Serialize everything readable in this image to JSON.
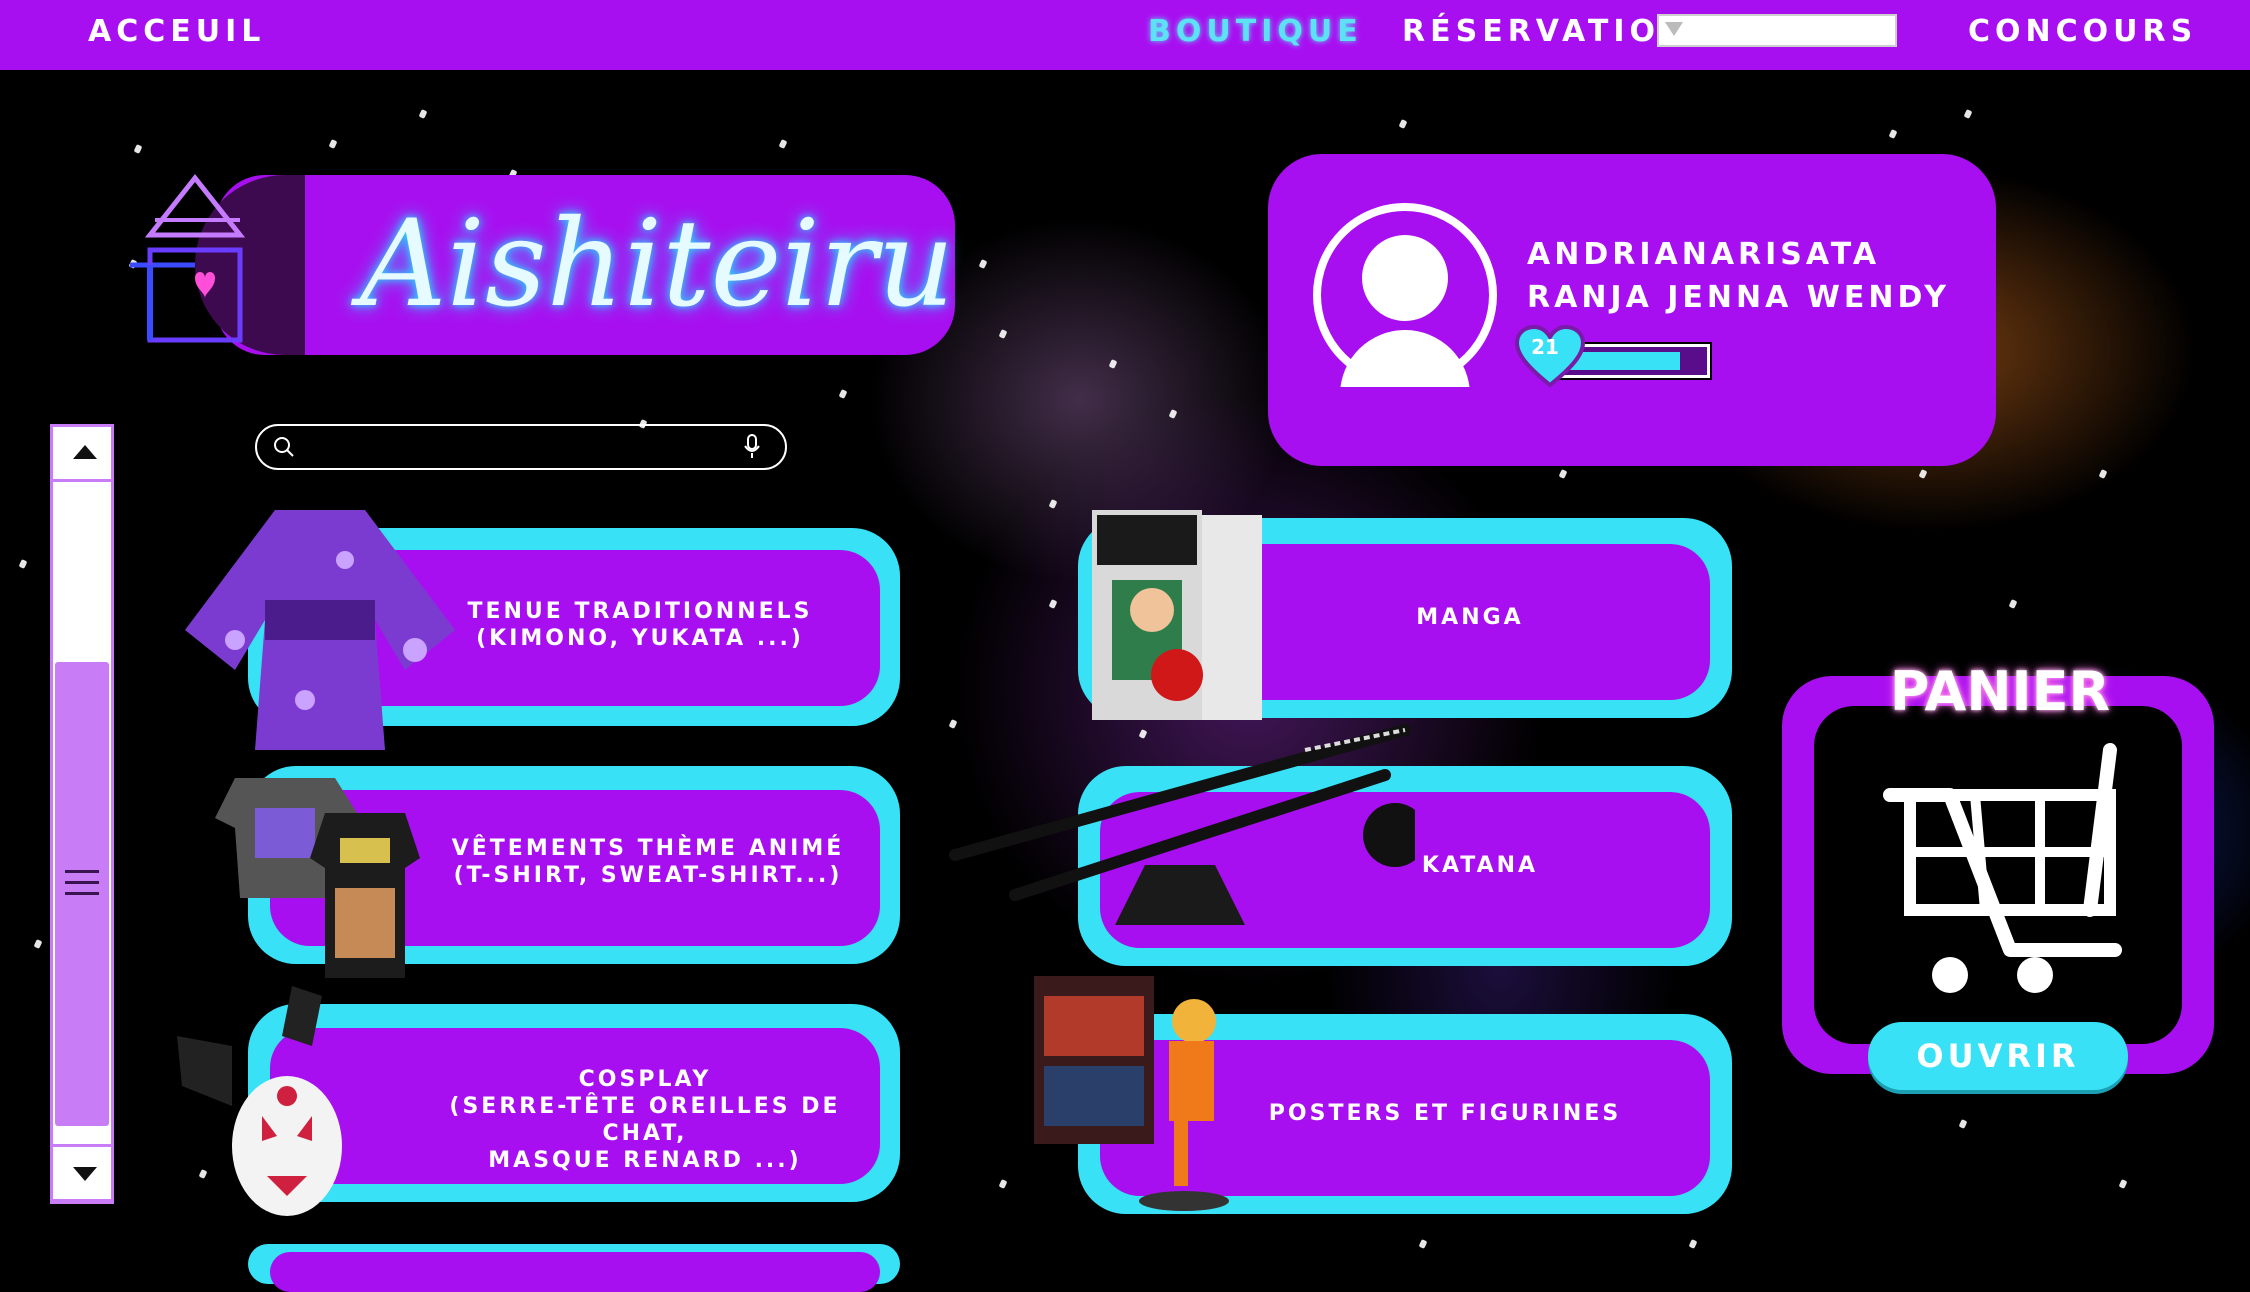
{
  "nav": {
    "home": "ACCEUIL",
    "shop": "BOUTIQUE",
    "reservation": "RÉSERVATION",
    "contest": "CONCOURS",
    "reservation_select_value": ""
  },
  "logo": {
    "text": "Aishiteiru"
  },
  "search": {
    "placeholder": ""
  },
  "categories_left": [
    {
      "label": "TENUE TRADITIONNELS\n(KIMONO, YUKATA ...)"
    },
    {
      "label": "VÊTEMENTS THÈME ANIMÉ\n(T-SHIRT, SWEAT-SHIRT...)"
    },
    {
      "label": "COSPLAY\n(SERRE-TÊTE OREILLES DE CHAT,\nMASQUE RENARD ...)"
    }
  ],
  "categories_right": [
    {
      "label": "MANGA"
    },
    {
      "label": "KATANA"
    },
    {
      "label": "POSTERS ET FIGURINES"
    }
  ],
  "profile": {
    "name_line1": "ANDRIANARISATA",
    "name_line2": "RANJA JENNA WENDY",
    "level": "21",
    "level_progress": 0.85
  },
  "cart": {
    "title": "PANIER",
    "button": "OUVRIR"
  },
  "colors": {
    "primary": "#a80ff0",
    "accent": "#38e1f5",
    "scroll": "#c87cf5"
  },
  "icons": [
    "search-icon",
    "microphone-icon",
    "cart-icon",
    "heart-icon",
    "user-icon",
    "house-heart-icon",
    "arrow-up-icon",
    "arrow-down-icon",
    "menu-icon"
  ]
}
